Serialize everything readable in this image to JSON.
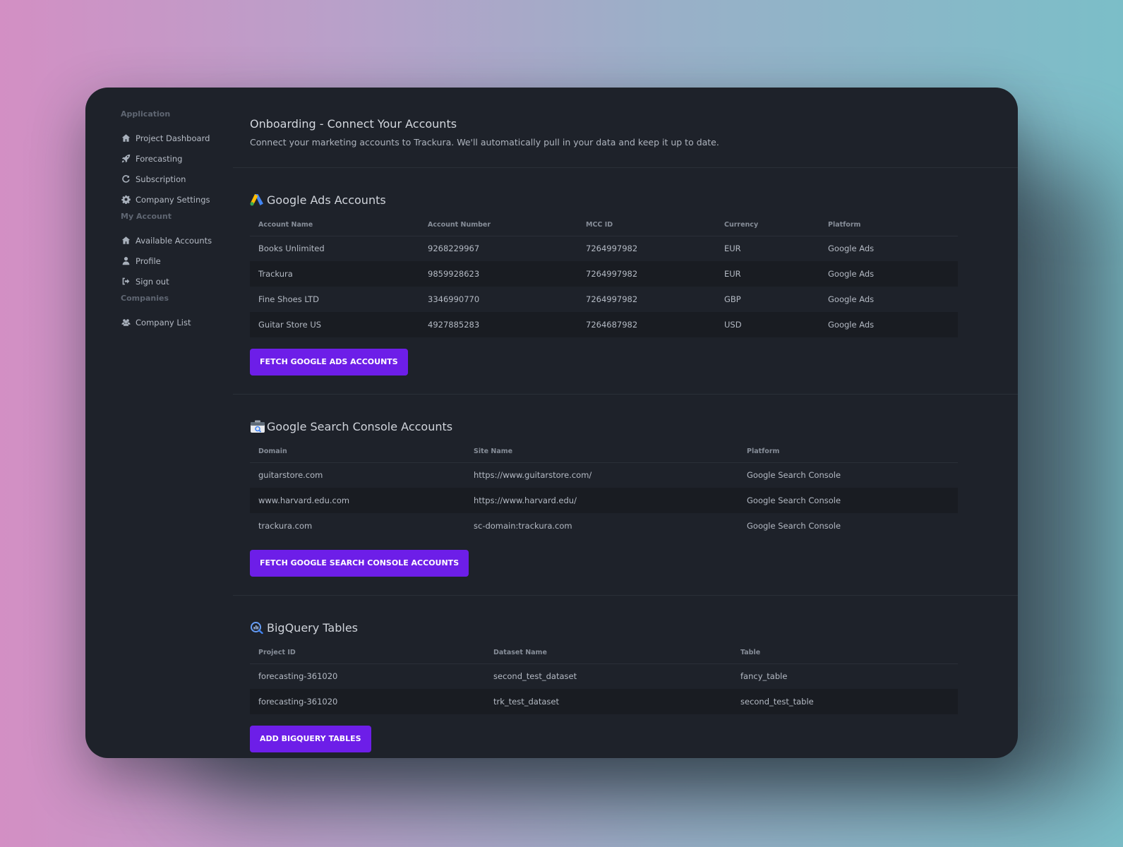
{
  "sidebar": {
    "groups": [
      {
        "heading": "Application",
        "items": [
          {
            "label": "Project Dashboard",
            "icon": "home-icon"
          },
          {
            "label": "Forecasting",
            "icon": "rocket-icon"
          },
          {
            "label": "Subscription",
            "icon": "refresh-icon"
          },
          {
            "label": "Company Settings",
            "icon": "gear-icon"
          }
        ]
      },
      {
        "heading": "My Account",
        "items": [
          {
            "label": "Available Accounts",
            "icon": "home-icon"
          },
          {
            "label": "Profile",
            "icon": "user-icon"
          },
          {
            "label": "Sign out",
            "icon": "sign-out-icon"
          }
        ]
      },
      {
        "heading": "Companies",
        "items": [
          {
            "label": "Company List",
            "icon": "users-icon"
          }
        ]
      }
    ]
  },
  "header": {
    "title": "Onboarding - Connect Your Accounts",
    "subtitle": "Connect your marketing accounts to Trackura. We'll automatically pull in your data and keep it up to date."
  },
  "google_ads": {
    "title": "Google Ads Accounts",
    "columns": [
      "Account Name",
      "Account Number",
      "MCC ID",
      "Currency",
      "Platform"
    ],
    "rows": [
      [
        "Books Unlimited",
        "9268229967",
        "7264997982",
        "EUR",
        "Google Ads"
      ],
      [
        "Trackura",
        "9859928623",
        "7264997982",
        "EUR",
        "Google Ads"
      ],
      [
        "Fine Shoes LTD",
        "3346990770",
        "7264997982",
        "GBP",
        "Google Ads"
      ],
      [
        "Guitar Store US",
        "4927885283",
        "7264687982",
        "USD",
        "Google Ads"
      ]
    ],
    "button": "FETCH GOOGLE ADS ACCOUNTS"
  },
  "search_console": {
    "title": "Google Search Console Accounts",
    "columns": [
      "Domain",
      "Site Name",
      "Platform"
    ],
    "rows": [
      [
        "guitarstore.com",
        "https://www.guitarstore.com/",
        "Google Search Console"
      ],
      [
        "www.harvard.edu.com",
        "https://www.harvard.edu/",
        "Google Search Console"
      ],
      [
        "trackura.com",
        "sc-domain:trackura.com",
        "Google Search Console"
      ]
    ],
    "button": "FETCH GOOGLE SEARCH CONSOLE ACCOUNTS"
  },
  "bigquery": {
    "title": "BigQuery Tables",
    "columns": [
      "Project ID",
      "Dataset Name",
      "Table"
    ],
    "rows": [
      [
        "forecasting-361020",
        "second_test_dataset",
        "fancy_table"
      ],
      [
        "forecasting-361020",
        "trk_test_dataset",
        "second_test_table"
      ]
    ],
    "button": "ADD BIGQUERY TABLES"
  },
  "colors": {
    "accent": "#6d1ee8",
    "window_bg": "#1e222a"
  }
}
